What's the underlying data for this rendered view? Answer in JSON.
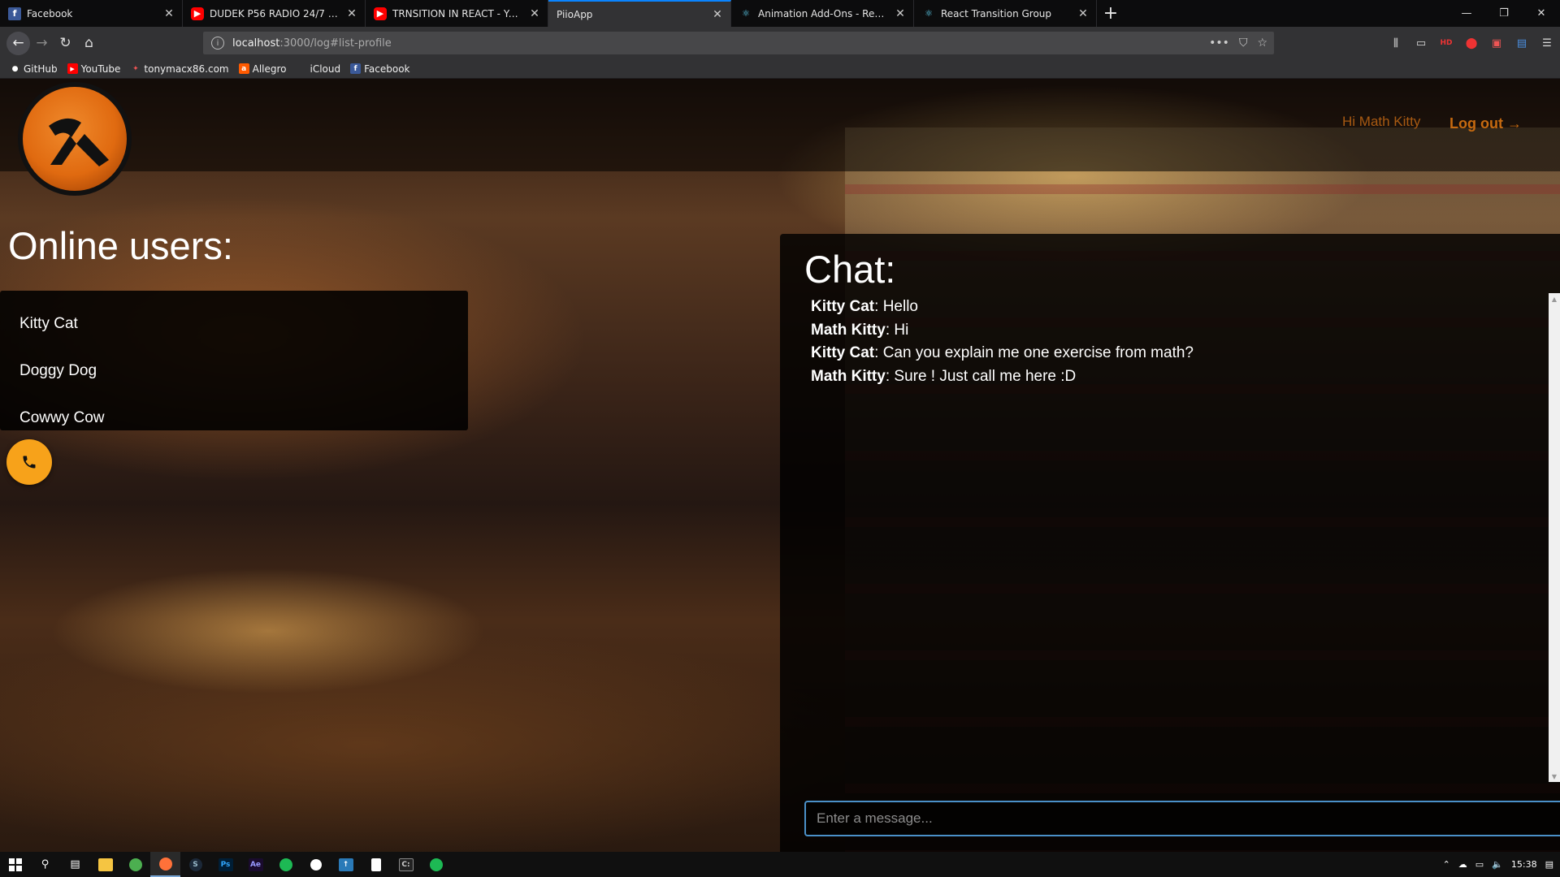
{
  "tabs": [
    {
      "title": "Facebook",
      "favicon": "f",
      "kind": "fb"
    },
    {
      "title": "DUDEK P56 RADIO 24/7 - YouTube",
      "favicon": "▶",
      "kind": "yt"
    },
    {
      "title": "TRNSITION IN REACT - YouTube",
      "favicon": "▶",
      "kind": "yt"
    },
    {
      "title": "PiioApp",
      "favicon": "",
      "kind": "none",
      "active": true
    },
    {
      "title": "Animation Add-Ons - React",
      "favicon": "⚛",
      "kind": "react"
    },
    {
      "title": "React Transition Group",
      "favicon": "⚛",
      "kind": "react"
    }
  ],
  "new_tab_label": "+",
  "window_controls": {
    "minimize": "—",
    "maximize": "❐",
    "close": "✕"
  },
  "url": {
    "host": "localhost",
    "rest": ":3000/log#list-profile"
  },
  "bookmarks": [
    {
      "label": "GitHub",
      "icon": "github-icon"
    },
    {
      "label": "YouTube",
      "icon": "youtube-icon"
    },
    {
      "label": "tonymacx86.com",
      "icon": "tonymac-icon"
    },
    {
      "label": "Allegro",
      "icon": "allegro-icon"
    },
    {
      "label": "iCloud",
      "icon": "apple-icon"
    },
    {
      "label": "Facebook",
      "icon": "facebook-icon"
    }
  ],
  "header": {
    "greeting": "Hi Math Kitty",
    "logout": "Log out →"
  },
  "online_users": {
    "title": "Online users:",
    "users": [
      "Kitty Cat",
      "Doggy Dog",
      "Cowwy Cow"
    ]
  },
  "chat": {
    "title": "Chat:",
    "messages": [
      {
        "author": "Kitty Cat",
        "text": "Hello"
      },
      {
        "author": "Math Kitty",
        "text": "Hi"
      },
      {
        "author": "Kitty Cat",
        "text": "Can you explain me one exercise from math?"
      },
      {
        "author": "Math Kitty",
        "text": "Sure ! Just call me here :D"
      }
    ],
    "input_placeholder": "Enter a message..."
  },
  "taskbar": {
    "clock": "15:38"
  },
  "colors": {
    "accent_orange": "#f7a21a",
    "logout_orange": "#c66a10",
    "tab_active_blue": "#0a84ff"
  }
}
